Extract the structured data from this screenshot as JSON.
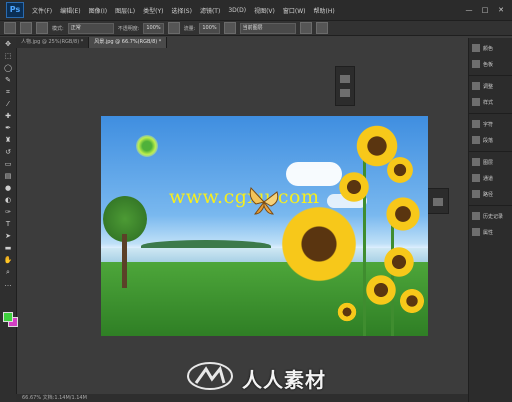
{
  "app": {
    "logo_text": "Ps"
  },
  "menu": {
    "items": [
      "文件(F)",
      "编辑(E)",
      "图像(I)",
      "图层(L)",
      "类型(Y)",
      "选择(S)",
      "滤镜(T)",
      "3D(D)",
      "视图(V)",
      "窗口(W)",
      "帮助(H)"
    ]
  },
  "window_controls": {
    "minimize": "—",
    "maximize": "□",
    "close": "✕"
  },
  "options_bar": {
    "mode_label": "模式:",
    "mode_value": "正常",
    "opacity_label": "不透明度:",
    "opacity_value": "100%",
    "flow_label": "流量:",
    "flow_value": "100%",
    "sample_value": "当前图层"
  },
  "tabs": [
    {
      "label": "人物.jpg @ 25%(RGB/8) *",
      "active": false
    },
    {
      "label": "风景.jpg @ 66.7%(RGB/8) *",
      "active": true
    }
  ],
  "canvas": {
    "watermark_text": "www.cgxu.com"
  },
  "panels": [
    {
      "label": "颜色"
    },
    {
      "label": "色板"
    },
    {
      "label": "调整"
    },
    {
      "label": "样式"
    },
    {
      "label": "字符"
    },
    {
      "label": "段落"
    },
    {
      "label": "图层"
    },
    {
      "label": "通道"
    },
    {
      "label": "路径"
    },
    {
      "label": "历史记录"
    },
    {
      "label": "属性"
    }
  ],
  "status": {
    "text": "66.67%   文档:1.14M/1.14M"
  },
  "bottom_watermark": {
    "text": "人人素材"
  },
  "colors": {
    "foreground": "#3ed13e",
    "background": "#d43fc4"
  }
}
